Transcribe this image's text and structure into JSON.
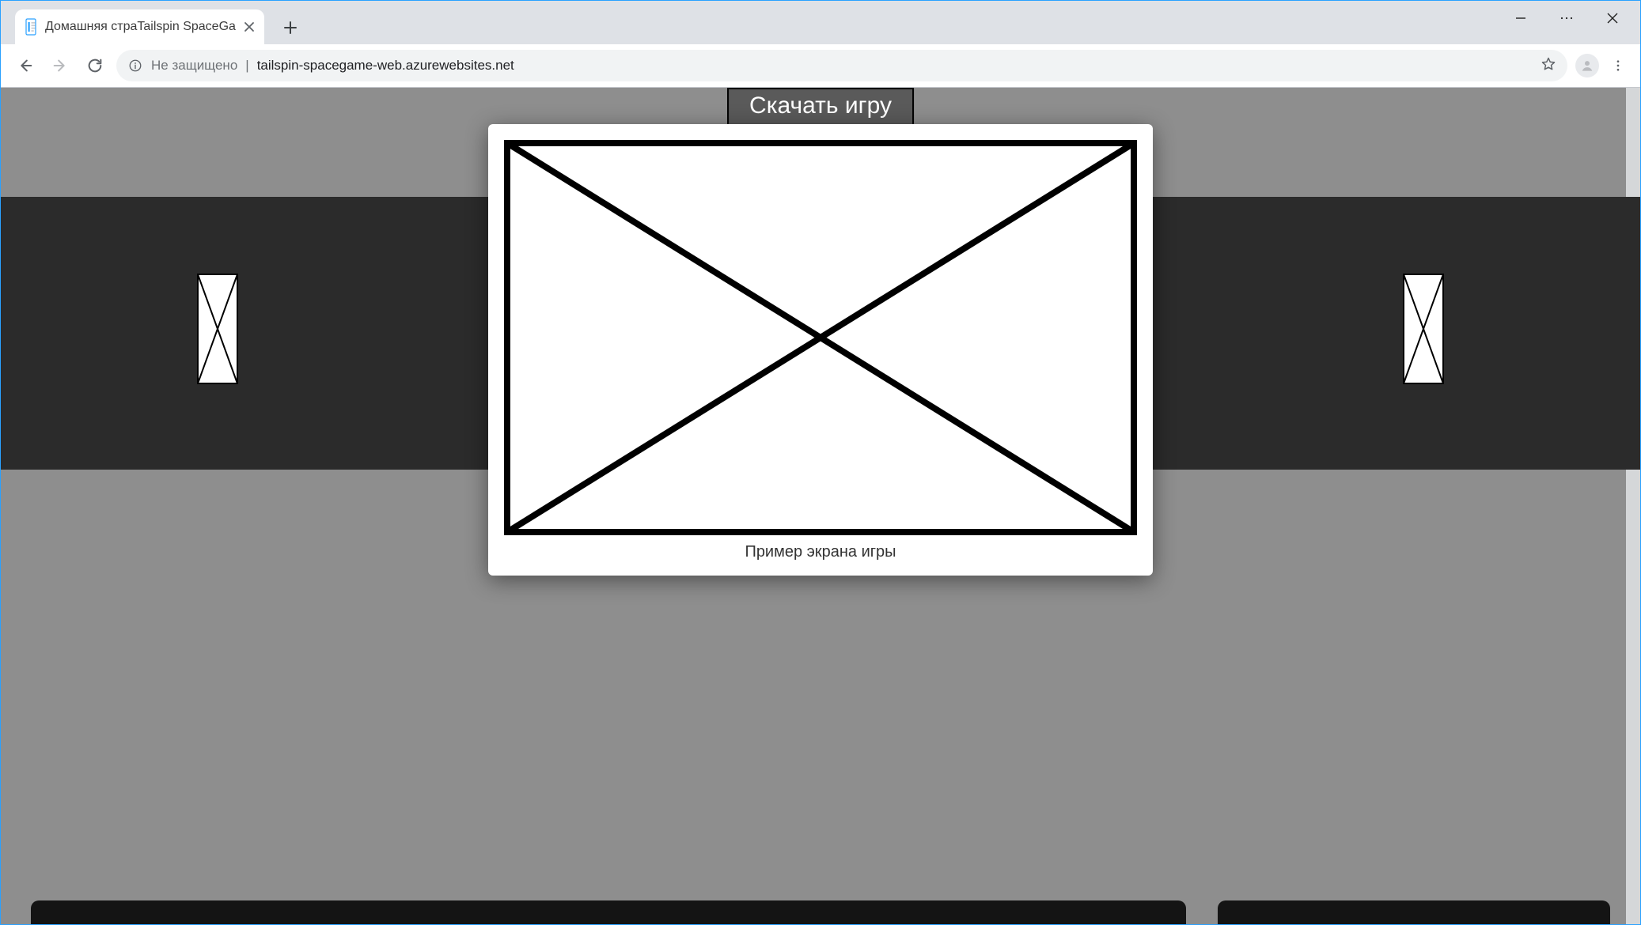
{
  "browser": {
    "tab_title_prefix": "Домашняя стра",
    "tab_title_bold": "Tailspin SpaceGame",
    "url_security_label": "Не защищено",
    "url_separator": " |",
    "url_host": "tailspin-spacegame-web.azurewebsites.net"
  },
  "page": {
    "download_label": "Скачать игру"
  },
  "modal": {
    "caption": "Пример экрана игры"
  }
}
